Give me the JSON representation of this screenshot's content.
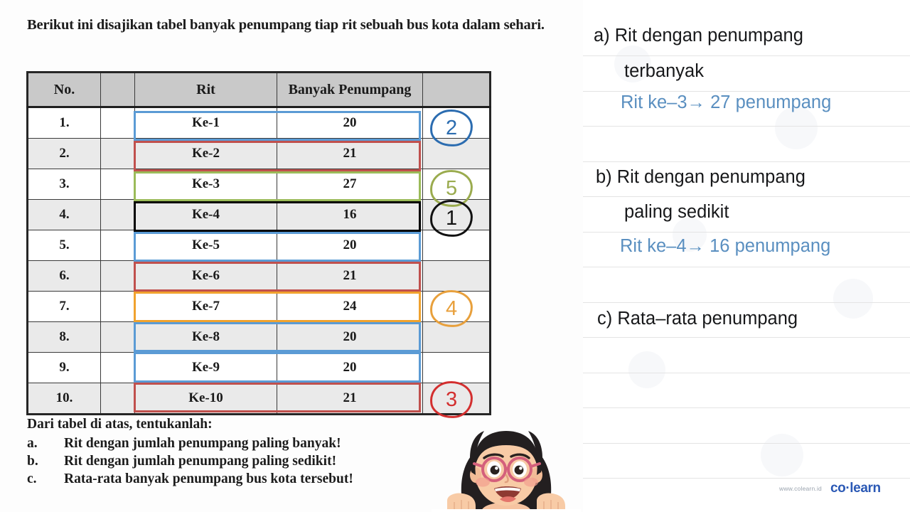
{
  "worksheet": {
    "intro": "Berikut ini disajikan tabel banyak penumpang tiap rit sebuah bus kota dalam sehari.",
    "table": {
      "headers": [
        "No.",
        "",
        "Rit",
        "Banyak Penumpang",
        ""
      ],
      "rows": [
        {
          "no": "1.",
          "rit": "Ke-1",
          "jumlah": "20",
          "mark": "2",
          "mark_color": "#2b6cb0"
        },
        {
          "no": "2.",
          "rit": "Ke-2",
          "jumlah": "21",
          "mark": "",
          "mark_color": ""
        },
        {
          "no": "3.",
          "rit": "Ke-3",
          "jumlah": "27",
          "mark": "5",
          "mark_color": "#9aab4e"
        },
        {
          "no": "4.",
          "rit": "Ke-4",
          "jumlah": "16",
          "mark": "1",
          "mark_color": "#111111"
        },
        {
          "no": "5.",
          "rit": "Ke-5",
          "jumlah": "20",
          "mark": "",
          "mark_color": ""
        },
        {
          "no": "6.",
          "rit": "Ke-6",
          "jumlah": "21",
          "mark": "",
          "mark_color": ""
        },
        {
          "no": "7.",
          "rit": "Ke-7",
          "jumlah": "24",
          "mark": "4",
          "mark_color": "#e8a03c"
        },
        {
          "no": "8.",
          "rit": "Ke-8",
          "jumlah": "20",
          "mark": "",
          "mark_color": ""
        },
        {
          "no": "9.",
          "rit": "Ke-9",
          "jumlah": "20",
          "mark": "",
          "mark_color": ""
        },
        {
          "no": "10.",
          "rit": "Ke-10",
          "jumlah": "21",
          "mark": "3",
          "mark_color": "#d32f2f"
        }
      ]
    },
    "questions": {
      "heading": "Dari tabel di atas, tentukanlah:",
      "items": [
        {
          "letter": "a.",
          "text": "Rit dengan jumlah penumpang paling banyak!"
        },
        {
          "letter": "b.",
          "text": "Rit dengan jumlah penumpang paling sedikit!"
        },
        {
          "letter": "c.",
          "text": "Rata-rata banyak penumpang bus kota tersebut!"
        }
      ]
    },
    "highlight_colors": {
      "blue": "#5b9bd5",
      "red": "#c0504d",
      "green": "#9bbb59",
      "black": "#000000",
      "orange": "#f0a22e"
    }
  },
  "answers": {
    "lines": [
      {
        "text": "a)  Rit dengan penumpang",
        "kind": "question"
      },
      {
        "text": "terbanyak",
        "kind": "question"
      },
      {
        "text": "Rit ke–3→ 27 penumpang",
        "kind": "answer"
      },
      {
        "text": "b) Rit dengan penumpang",
        "kind": "question"
      },
      {
        "text": "paling sedikit",
        "kind": "question"
      },
      {
        "text": "Rit ke–4→ 16 penumpang",
        "kind": "answer"
      },
      {
        "text": "c) Rata–rata penumpang",
        "kind": "question"
      }
    ]
  },
  "branding": {
    "url": "www.colearn.id",
    "name": "co·learn",
    "accent": "#2b59b5"
  },
  "chart_data": {
    "type": "table",
    "title": "Banyak penumpang tiap rit sebuah bus kota dalam sehari",
    "categories": [
      "Ke-1",
      "Ke-2",
      "Ke-3",
      "Ke-4",
      "Ke-5",
      "Ke-6",
      "Ke-7",
      "Ke-8",
      "Ke-9",
      "Ke-10"
    ],
    "values": [
      20,
      21,
      27,
      16,
      20,
      21,
      24,
      20,
      20,
      21
    ],
    "xlabel": "Rit",
    "ylabel": "Banyak Penumpang",
    "annotations": {
      "max": {
        "rit": "Ke-3",
        "value": 27
      },
      "min": {
        "rit": "Ke-4",
        "value": 16
      }
    }
  }
}
